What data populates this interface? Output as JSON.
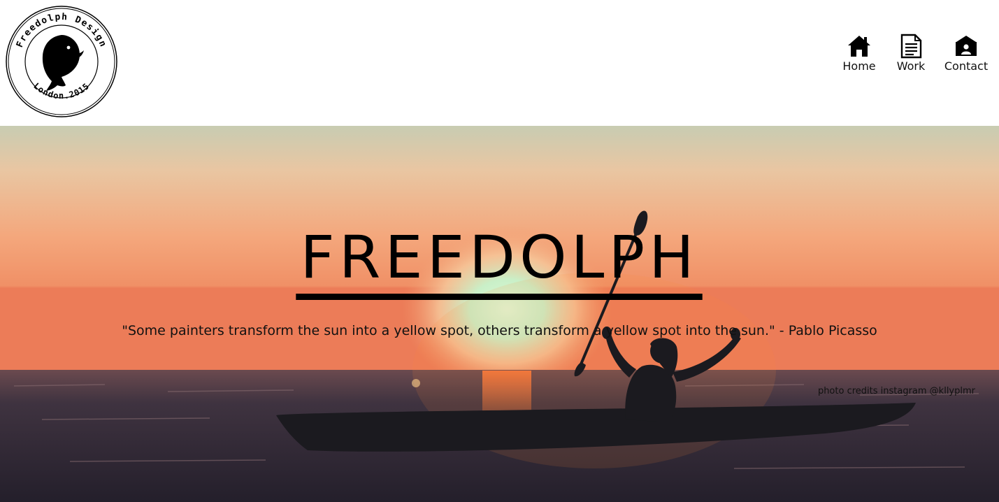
{
  "logo": {
    "top_text": "Freedolph Design",
    "bottom_text": "London.2015"
  },
  "nav": {
    "items": [
      {
        "label": "Home",
        "icon": "home-icon"
      },
      {
        "label": "Work",
        "icon": "document-icon"
      },
      {
        "label": "Contact",
        "icon": "contact-card-icon"
      }
    ]
  },
  "hero": {
    "title": "FREEDOLPH",
    "quote": "\"Some painters transform the sun into a yellow spot, others transform a yellow spot into the sun.\" - Pablo Picasso",
    "credits": "photo credits instagram @kllyplmr"
  },
  "colors": {
    "sky_top": "#c7cdb5",
    "sky_mid": "#f3a779",
    "horizon": "#ee7b56",
    "sun": "#d8f5d0",
    "sea": "#2f2a36",
    "text": "#111111"
  }
}
